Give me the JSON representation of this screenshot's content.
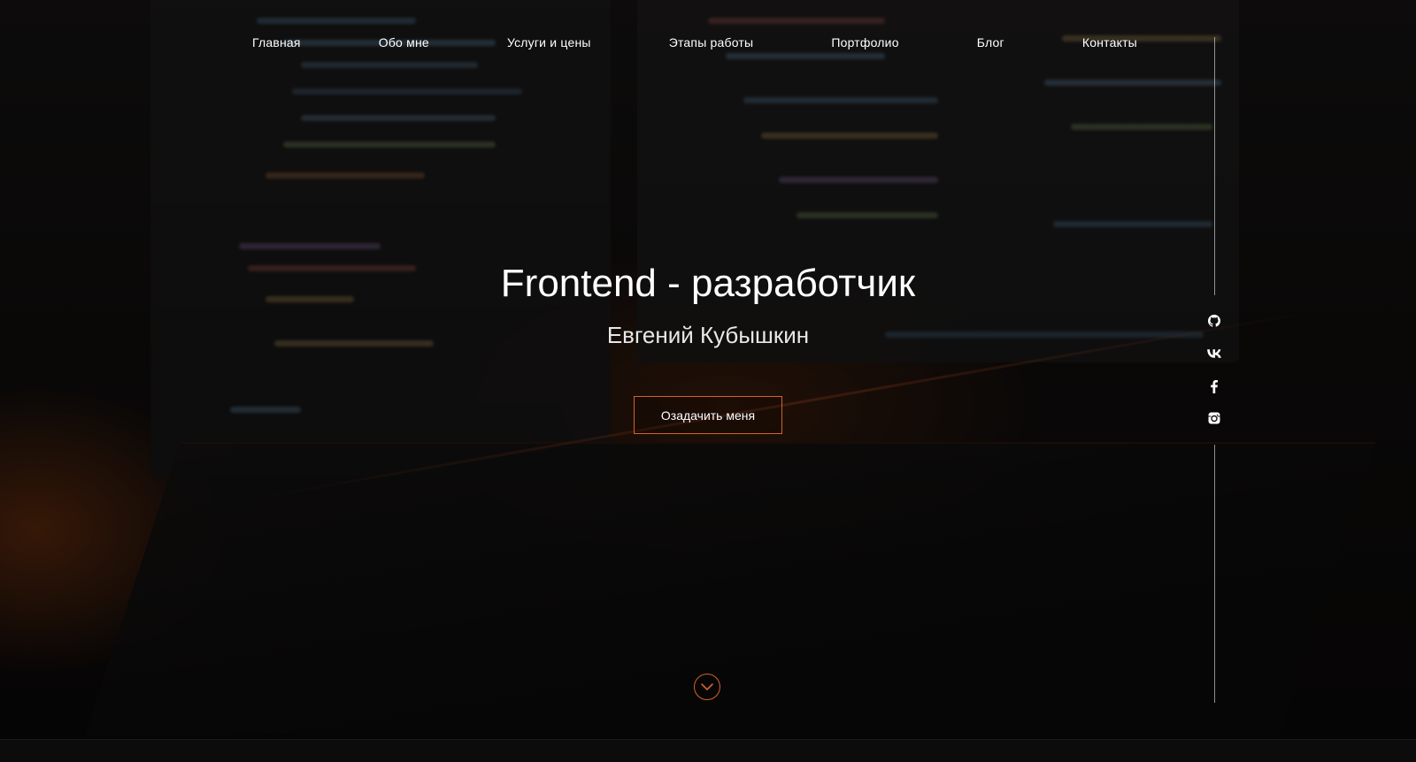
{
  "nav": {
    "items": [
      {
        "label": "Главная"
      },
      {
        "label": "Обо мне"
      },
      {
        "label": "Услуги и цены"
      },
      {
        "label": "Этапы работы"
      },
      {
        "label": "Портфолио"
      },
      {
        "label": "Блог"
      },
      {
        "label": "Контакты"
      }
    ]
  },
  "hero": {
    "title": "Frontend - разработчик",
    "subtitle": "Евгений Кубышкин",
    "cta_label": "Озадачить меня"
  },
  "social": {
    "icons": [
      "github-icon",
      "vk-icon",
      "facebook-icon",
      "instagram-icon"
    ]
  },
  "colors": {
    "accent": "#d4622a",
    "text": "#ffffff"
  }
}
